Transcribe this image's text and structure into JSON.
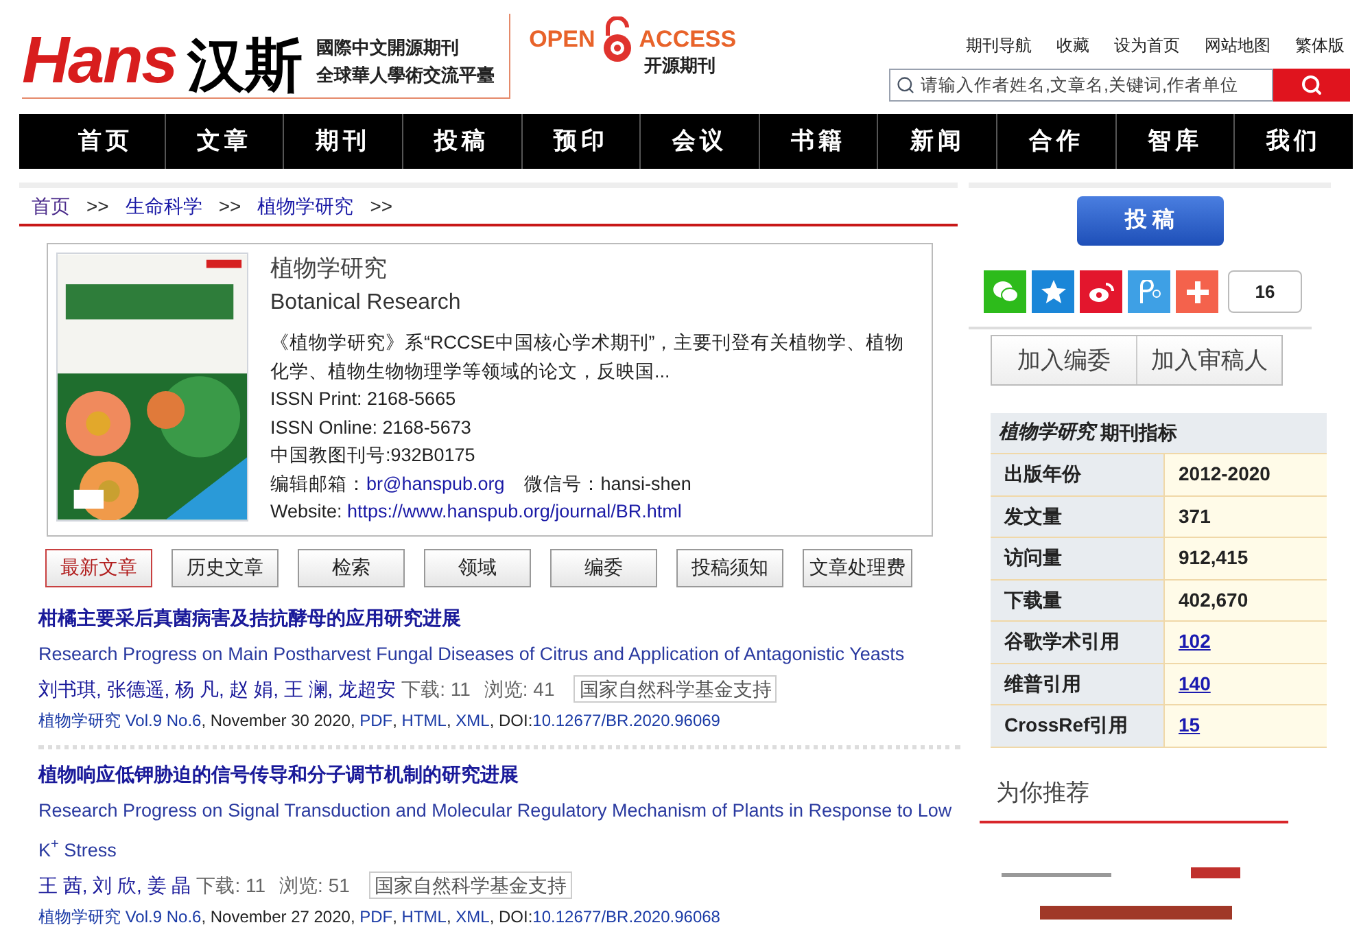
{
  "header": {
    "logo_latin": "Hans",
    "logo_cjk": "汉斯",
    "tagline": [
      "國際中文開源期刊",
      "全球華人學術交流平臺"
    ],
    "open_access": {
      "left": "OPEN",
      "right": "ACCESS",
      "sub": "开源期刊"
    },
    "top_links": [
      "期刊导航",
      "收藏",
      "设为首页",
      "网站地图",
      "繁体版"
    ],
    "search": {
      "placeholder": "请输入作者姓名,文章名,关键词,作者单位"
    }
  },
  "nav": [
    "首页",
    "文章",
    "期刊",
    "投稿",
    "预印",
    "会议",
    "书籍",
    "新闻",
    "合作",
    "智库",
    "我们"
  ],
  "breadcrumb": [
    {
      "label": "首页",
      "sep": ">>"
    },
    {
      "label": "生命科学",
      "sep": ">>"
    },
    {
      "label": "植物学研究",
      "sep": ">>"
    }
  ],
  "journal": {
    "title_cn": "植物学研究",
    "title_en": "Botanical Research",
    "description": "《植物学研究》系“RCCSE中国核心学术期刊”，主要刊登有关植物学、植物化学、植物生物物理学等领域的论文，反映国...",
    "issn_print": "ISSN Print: 2168-5665",
    "issn_online": "ISSN Online: 2168-5673",
    "cn_number": "中国教图刊号:932B0175",
    "email_label": "编辑邮箱：",
    "email": "br@hanspub.org",
    "wechat": "微信号：hansi-shen",
    "website_label": "Website: ",
    "website": "https://www.hanspub.org/journal/BR.html"
  },
  "tabs": [
    {
      "label": "最新文章",
      "selected": true
    },
    {
      "label": "历史文章",
      "selected": false
    },
    {
      "label": "检索",
      "selected": false
    },
    {
      "label": "领域",
      "selected": false
    },
    {
      "label": "编委",
      "selected": false
    },
    {
      "label": "投稿须知",
      "selected": false
    },
    {
      "label": "文章处理费",
      "selected": false
    }
  ],
  "articles": [
    {
      "title_cn": "柑橘主要采后真菌病害及拮抗酵母的应用研究进展",
      "title_en": "Research Progress on Main Postharvest Fungal Diseases of Citrus and Application of Antagonistic Yeasts",
      "authors": "刘书琪, 张德遥, 杨 凡, 赵 娟, 王 澜, 龙超安",
      "downloads": "下载: 11",
      "views": "浏览: 41",
      "fund": "国家自然科学基金支持",
      "meta": [
        {
          "text": "植物学研究",
          "link": true
        },
        {
          "text": " Vol.9 No.6",
          "link": true
        },
        {
          "text": ", November 30 2020, ",
          "link": false
        },
        {
          "text": "PDF",
          "link": true
        },
        {
          "text": ", ",
          "link": false
        },
        {
          "text": "HTML",
          "link": true
        },
        {
          "text": ", ",
          "link": false
        },
        {
          "text": "XML",
          "link": true
        },
        {
          "text": ", DOI:",
          "link": false
        },
        {
          "text": "10.12677/BR.2020.96069",
          "link": true
        }
      ]
    },
    {
      "title_cn": "植物响应低钾胁迫的信号传导和分子调节机制的研究进展",
      "title_en": "Research Progress on Signal Transduction and Molecular Regulatory Mechanism of Plants in Response to Low K$^{+}$ Stress",
      "authors": "王 茜, 刘 欣, 姜 晶",
      "downloads": "下载: 11",
      "views": "浏览: 51",
      "fund": "国家自然科学基金支持",
      "meta": [
        {
          "text": "植物学研究",
          "link": true
        },
        {
          "text": " Vol.9 No.6",
          "link": true
        },
        {
          "text": ", November 27 2020, ",
          "link": false
        },
        {
          "text": "PDF",
          "link": true
        },
        {
          "text": ", ",
          "link": false
        },
        {
          "text": "HTML",
          "link": true
        },
        {
          "text": ", ",
          "link": false
        },
        {
          "text": "XML",
          "link": true
        },
        {
          "text": ", DOI:",
          "link": false
        },
        {
          "text": "10.12677/BR.2020.96068",
          "link": true
        }
      ]
    }
  ],
  "sidebar": {
    "submit": "投 稿",
    "share": [
      {
        "kind": "wechat",
        "color": "#2dbb1b"
      },
      {
        "kind": "qzone",
        "color": "#1a86d8"
      },
      {
        "kind": "weibo",
        "color": "#e3162d"
      },
      {
        "kind": "tencent",
        "color": "#3ea0e5"
      },
      {
        "kind": "more",
        "color": "#f4624c"
      }
    ],
    "share_count": "16",
    "join": [
      "加入编委",
      "加入审稿人"
    ],
    "metrics": {
      "title_italic": "植物学研究",
      "title": " 期刊指标",
      "rows": [
        {
          "label": "出版年份",
          "value": "2012-2020",
          "link": false
        },
        {
          "label": "发文量",
          "value": "371",
          "link": false
        },
        {
          "label": "访问量",
          "value": "912,415",
          "link": false
        },
        {
          "label": "下载量",
          "value": "402,670",
          "link": false
        },
        {
          "label": "谷歌学术引用",
          "value": "102",
          "link": true
        },
        {
          "label": "维普引用",
          "value": "140",
          "link": true
        },
        {
          "label": "CrossRef引用",
          "value": "15",
          "link": true
        }
      ]
    },
    "recommend": "为你推荐"
  }
}
